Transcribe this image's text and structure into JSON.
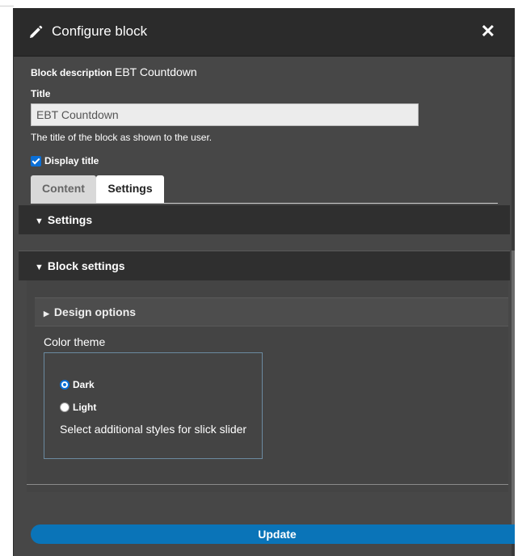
{
  "dialog": {
    "title": "Configure block",
    "close_symbol": "✕",
    "icons": {
      "edit": "pencil-icon",
      "close": "close-icon"
    }
  },
  "form": {
    "block_description_label": "Block description",
    "block_description_value": "EBT Countdown",
    "title_label": "Title",
    "title_value": "EBT Countdown",
    "title_help": "The title of the block as shown to the user.",
    "display_title_label": "Display title",
    "display_title_checked": true
  },
  "tabs": [
    {
      "label": "Content",
      "active": false
    },
    {
      "label": "Settings",
      "active": true
    }
  ],
  "sections": {
    "settings_label": "Settings",
    "block_settings_label": "Block settings",
    "design_options_label": "Design options",
    "expanded_marker": "▼",
    "collapsed_marker": "▶"
  },
  "color_theme": {
    "label": "Color theme",
    "options": [
      {
        "label": "Dark",
        "selected": true
      },
      {
        "label": "Light",
        "selected": false
      }
    ],
    "help": "Select additional styles for slick slider"
  },
  "actions": {
    "update_label": "Update"
  },
  "colors": {
    "accent": "#0a74b8",
    "checkbox": "#0b6fd6",
    "panel": "#474747",
    "titlebar": "#2b2b2b"
  }
}
